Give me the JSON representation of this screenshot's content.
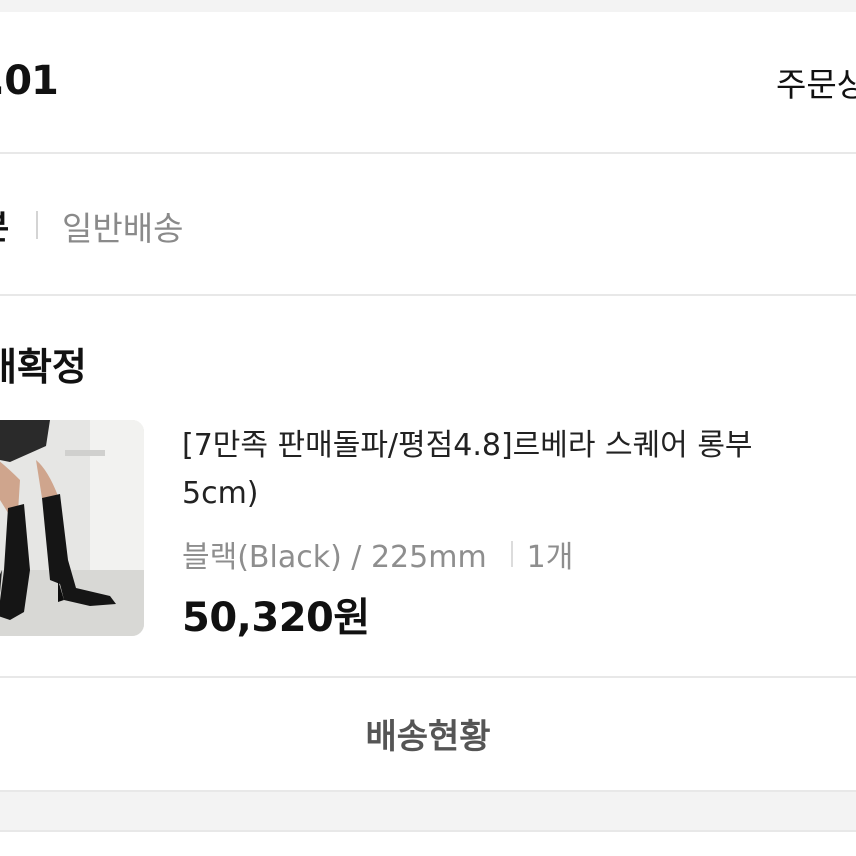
{
  "order": {
    "date": ".01",
    "detail_link": "주문상"
  },
  "shipping": {
    "label": "본",
    "type": "일반배송"
  },
  "status": {
    "label": "매확정"
  },
  "product": {
    "name_line1": "[7만족 판매돌파/평점4.8]르베라 스퀘어 롱부",
    "name_line2": "5cm)",
    "option": "블랙(Black) / 225mm",
    "quantity": "1개",
    "price": "50,320원",
    "thumbnail_icon": "product-thumbnail-black-long-boots"
  },
  "actions": {
    "track_label": "배송현황"
  },
  "colors": {
    "text_primary": "#111111",
    "text_secondary": "#8a8a8a",
    "divider": "#e8e8e8",
    "background_gap": "#f3f3f3"
  }
}
